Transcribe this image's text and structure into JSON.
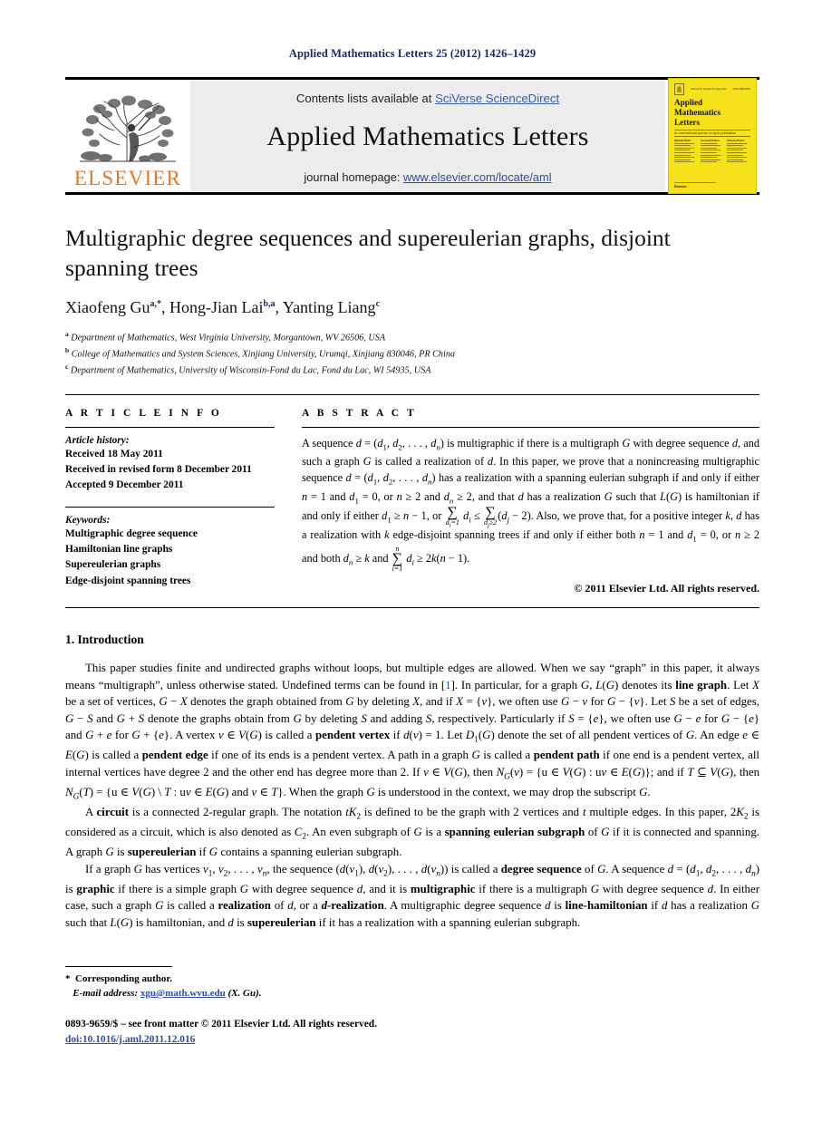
{
  "running_head": "Applied Mathematics Letters 25 (2012) 1426–1429",
  "masthead": {
    "contents_prefix": "Contents lists available at ",
    "contents_link": "SciVerse ScienceDirect",
    "journal_name": "Applied Mathematics Letters",
    "homepage_prefix": "journal homepage: ",
    "homepage_url": "www.elsevier.com/locate/aml",
    "publisher_wordmark": "ELSEVIER",
    "publisher_color": "#E87722",
    "link_color": "#2c4fa0"
  },
  "cover": {
    "issue_line": "Volume 25, Number 10, May 2012",
    "issn_line": "ISSN 0893-9659",
    "title_line1": "Applied",
    "title_line2": "Mathematics",
    "title_line3": "Letters",
    "subtitle": "an international journal of rapid publication",
    "section_label": "Editorial Board",
    "col1_head": "Editorial Board",
    "col2_head": "Associate Editors",
    "col3_head": "Advisory Board",
    "brand": "Elsevier",
    "bg_color": "#f7e11a"
  },
  "article": {
    "title": "Multigraphic degree sequences and supereulerian graphs, disjoint spanning trees",
    "authors": [
      {
        "name": "Xiaofeng Gu",
        "sup": "a,*"
      },
      {
        "name": "Hong-Jian Lai",
        "sup": "b,a"
      },
      {
        "name": "Yanting Liang",
        "sup": "c"
      }
    ],
    "affiliations": [
      {
        "mark": "a",
        "text": "Department of Mathematics, West Virginia University, Morgantown, WV 26506, USA"
      },
      {
        "mark": "b",
        "text": "College of Mathematics and System Sciences, Xinjiang University, Urumqi, Xinjiang 830046, PR China"
      },
      {
        "mark": "c",
        "text": "Department of Mathematics, University of Wisconsin-Fond du Lac, Fond du Lac, WI 54935, USA"
      }
    ]
  },
  "article_info": {
    "heading": "A R T I C L E    I N F O",
    "history_label": "Article history:",
    "history": [
      "Received 18 May 2011",
      "Received in revised form 8 December 2011",
      "Accepted 9 December 2011"
    ],
    "keywords_label": "Keywords:",
    "keywords": [
      "Multigraphic degree sequence",
      "Hamiltonian line graphs",
      "Supereulerian graphs",
      "Edge-disjoint spanning trees"
    ]
  },
  "abstract": {
    "heading": "A B S T R A C T",
    "copyright": "© 2011 Elsevier Ltd. All rights reserved."
  },
  "introduction": {
    "heading": "1.  Introduction"
  },
  "footnote": {
    "corresponding": "Corresponding author.",
    "email_label": "E-mail address:",
    "email": "xgu@math.wvu.edu",
    "email_suffix": "(X. Gu).",
    "imprint": "0893-9659/$ – see front matter © 2011 Elsevier Ltd. All rights reserved.",
    "doi": "doi:10.1016/j.aml.2011.12.016"
  }
}
